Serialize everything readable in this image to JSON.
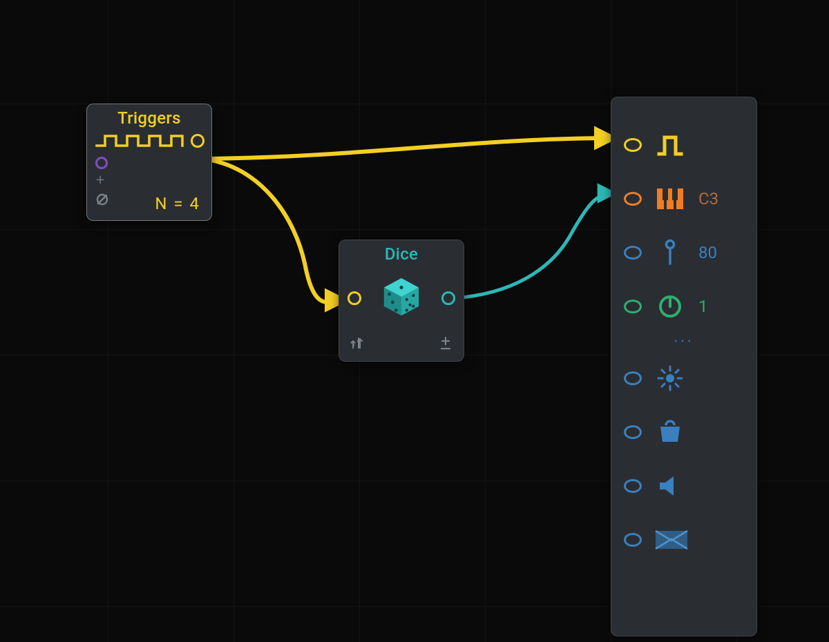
{
  "triggers": {
    "title": "Triggers",
    "n_value": "N = 4"
  },
  "dice": {
    "title": "Dice"
  },
  "output": {
    "pitch_value": "C3",
    "pin_value": "80",
    "knob_value": "1",
    "more_dots": "···"
  },
  "colors": {
    "yellow": "#f3cf23",
    "orange": "#f07d24",
    "teal": "#2cb8b6",
    "blue": "#3a7fbf",
    "green": "#2fae6f",
    "purple": "#7f4fbf"
  }
}
